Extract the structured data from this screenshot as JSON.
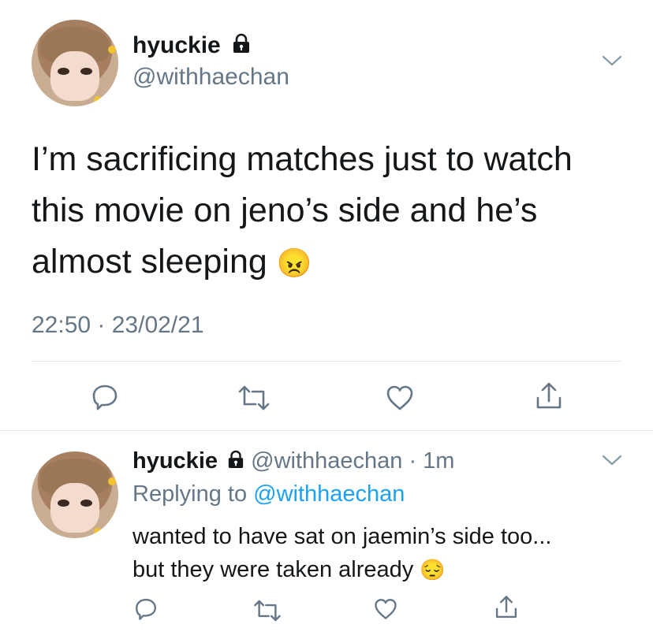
{
  "main_tweet": {
    "display_name": "hyuckie",
    "handle": "@withhaechan",
    "text_lines": [
      "I’m sacrificing matches just to watch",
      "this movie on jeno’s side and he’s",
      "almost sleeping"
    ],
    "emoji": "😠",
    "timestamp": "22:50 · 23/02/21",
    "actions": [
      "reply-icon",
      "retweet-icon",
      "like-icon",
      "share-icon"
    ]
  },
  "reply_tweet": {
    "display_name": "hyuckie",
    "handle": "@withhaechan",
    "time": "· 1m",
    "replying_prefix": "Replying to",
    "replying_handle": "@withhaechan",
    "text_lines": [
      "wanted to have sat on jaemin’s side too...",
      "but they were taken already"
    ],
    "emoji": "😔",
    "actions": [
      "reply-icon",
      "retweet-icon",
      "like-icon",
      "share-icon"
    ]
  },
  "colors": {
    "text": "#14171a",
    "secondary": "#657786",
    "link": "#1da1f2",
    "divider": "#e1e8ed"
  }
}
